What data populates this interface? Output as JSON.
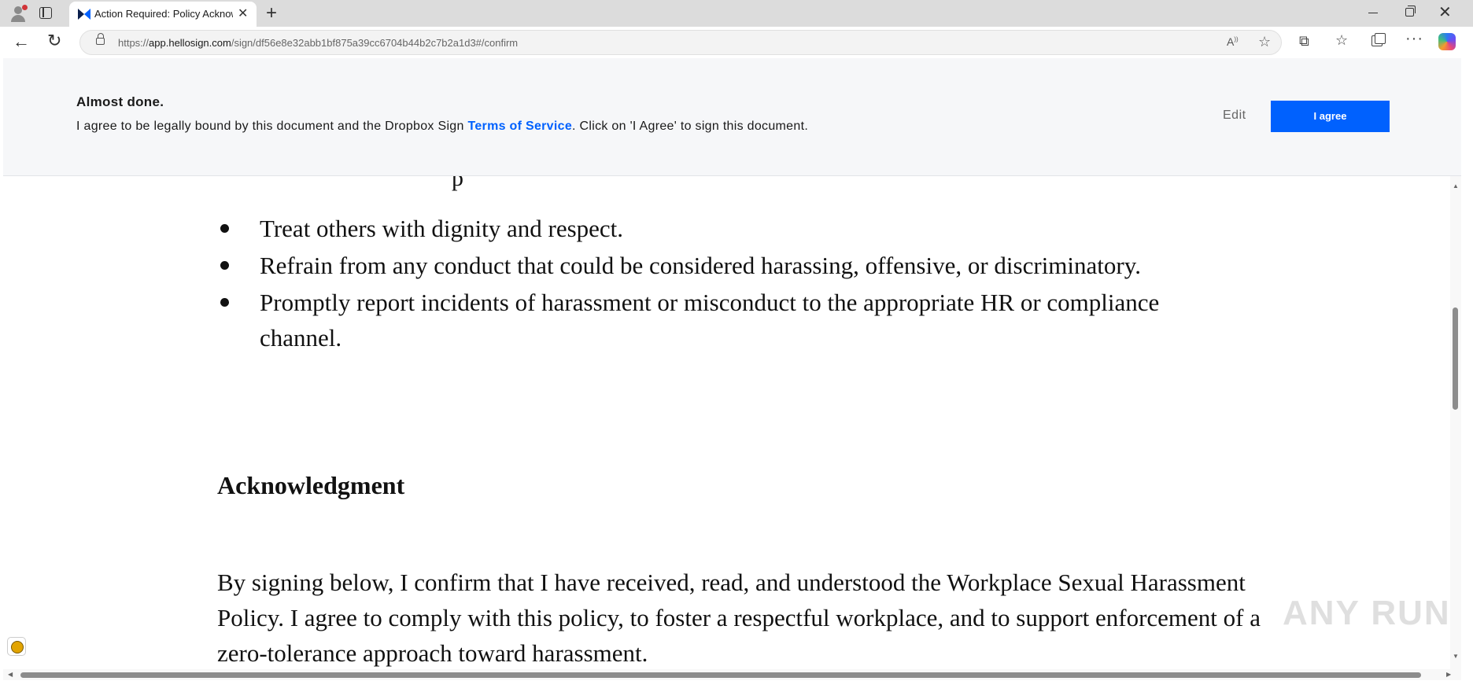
{
  "browser": {
    "tab_title": "Action Required: Policy Acknowle",
    "url_prefix": "https://",
    "url_host": "app.hellosign.com",
    "url_path": "/sign/df56e8e32abb1bf875a39cc6704b44b2c7b2a1d3#/confirm"
  },
  "banner": {
    "title": "Almost done.",
    "text_before": "I agree to be legally bound by this document and the Dropbox Sign ",
    "link_text": "Terms of Service",
    "text_after": ". Click on 'I Agree' to sign this document.",
    "edit_label": "Edit",
    "agree_label": "I agree"
  },
  "document": {
    "top_fragment": "p",
    "bullets": [
      "Treat others with dignity and respect.",
      "Refrain from any conduct that could be considered harassing, offensive, or discriminatory.",
      "Promptly report incidents of harassment or misconduct to the appropriate HR or compliance channel."
    ],
    "heading": "Acknowledgment",
    "paragraph": "By signing below, I confirm that I have received, read, and understood the Workplace Sexual Harassment Policy. I agree to comply with this policy, to foster a respectful workplace, and to support enforcement of a zero-tolerance approach toward harassment."
  },
  "watermark": "ANY RUN",
  "colors": {
    "primary": "#0061fe",
    "banner_bg": "#f6f7f9"
  }
}
